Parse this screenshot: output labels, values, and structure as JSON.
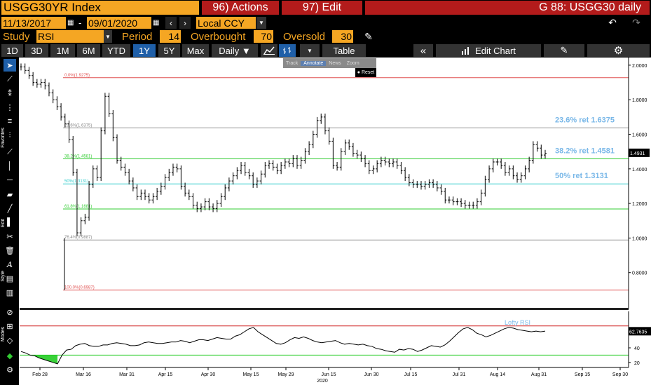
{
  "header": {
    "security": "USGG30YR Index",
    "actions": "96) Actions",
    "edit": "97) Edit",
    "title": "G 88: USGG30 daily"
  },
  "range": {
    "start": "11/13/2017",
    "dash": "-",
    "end": "09/01/2020",
    "currency": "Local CCY"
  },
  "study": {
    "label": "Study",
    "value": "RSI",
    "period_label": "Period",
    "period": "14",
    "overbought_label": "Overbought",
    "overbought": "70",
    "oversold_label": "Oversold",
    "oversold": "30"
  },
  "toolbar": {
    "periods": [
      "1D",
      "3D",
      "1M",
      "6M",
      "YTD",
      "1Y",
      "5Y",
      "Max"
    ],
    "active_period": "1Y",
    "frequency": "Daily",
    "table": "Table",
    "edit_chart": "Edit Chart"
  },
  "popup": {
    "tools": [
      "Track",
      "Annotate",
      "News",
      "Zoom"
    ],
    "reset": "Reset"
  },
  "side_labels": {
    "favorites": "Favorites",
    "edit": "Edit",
    "style": "Style",
    "modes": "Modes"
  },
  "colors": {
    "accent": "#f5a623",
    "header_red": "#b31b1b",
    "fib_red": "#e05050",
    "fib_green": "#33cc33",
    "fib_cyan": "#33cccc",
    "fib_label": "#7ab8e8"
  },
  "chart_data": [
    {
      "type": "line",
      "title": "",
      "x_ticks": [
        "Feb 28",
        "Mar 16",
        "Mar 31",
        "Apr 15",
        "Apr 30",
        "May 15",
        "May 29",
        "Jun 15",
        "Jun 30",
        "Jul 15",
        "Jul 31",
        "Aug 14",
        "Aug 31",
        "Sep 15",
        "Sep 30"
      ],
      "x_year": "2020",
      "y_ticks": [
        "2.0000",
        "1.8000",
        "1.6000",
        "1.4000",
        "1.2000",
        "1.0000",
        "0.8000"
      ],
      "ylim": [
        0.6,
        2.02
      ],
      "last_value": "1.4931",
      "fib_levels": [
        {
          "label": "0.0%(1.9275)",
          "value": 1.9275,
          "color": "red"
        },
        {
          "label": "23.6%(1.6375)",
          "value": 1.6375,
          "color": "gray"
        },
        {
          "label": "38.2%(1.4581)",
          "value": 1.4581,
          "color": "green"
        },
        {
          "label": "50%(1.3131)",
          "value": 1.3131,
          "color": "cyan"
        },
        {
          "label": "61.8%(1.1681)",
          "value": 1.1681,
          "color": "green"
        },
        {
          "label": "76.4%(0.9887)",
          "value": 0.9887,
          "color": "gray"
        },
        {
          "label": "100.0%(0.6987)",
          "value": 0.6987,
          "color": "red"
        }
      ],
      "fib_annotations": [
        "23.6% ret 1.6375",
        "38.2% ret 1.4581",
        "50% ret 1.3131"
      ],
      "series": [
        {
          "values": [
            1.99,
            1.97,
            1.94,
            1.9,
            1.89,
            1.9,
            1.88,
            1.84,
            1.8,
            1.76,
            1.7,
            1.66,
            1.57,
            1.38,
            1.03,
            1.1,
            1.12,
            1.31,
            1.4,
            1.35,
            1.62,
            1.82,
            1.72,
            1.58,
            1.45,
            1.41,
            1.38,
            1.33,
            1.29,
            1.24,
            1.26,
            1.24,
            1.22,
            1.24,
            1.27,
            1.3,
            1.35,
            1.38,
            1.41,
            1.4,
            1.3,
            1.26,
            1.24,
            1.19,
            1.17,
            1.18,
            1.21,
            1.18,
            1.17,
            1.2,
            1.24,
            1.29,
            1.33,
            1.36,
            1.39,
            1.42,
            1.38,
            1.36,
            1.31,
            1.33,
            1.37,
            1.42,
            1.43,
            1.41,
            1.39,
            1.42,
            1.44,
            1.43,
            1.46,
            1.42,
            1.45,
            1.5,
            1.54,
            1.6,
            1.68,
            1.7,
            1.62,
            1.56,
            1.42,
            1.41,
            1.5,
            1.55,
            1.53,
            1.49,
            1.48,
            1.46,
            1.43,
            1.39,
            1.4,
            1.43,
            1.45,
            1.44,
            1.43,
            1.44,
            1.42,
            1.39,
            1.35,
            1.32,
            1.31,
            1.31,
            1.3,
            1.31,
            1.32,
            1.31,
            1.29,
            1.27,
            1.22,
            1.22,
            1.21,
            1.21,
            1.2,
            1.19,
            1.19,
            1.19,
            1.21,
            1.26,
            1.34,
            1.4,
            1.44,
            1.44,
            1.42,
            1.38,
            1.4,
            1.36,
            1.34,
            1.36,
            1.4,
            1.45,
            1.54,
            1.52,
            1.48,
            1.49
          ]
        }
      ]
    },
    {
      "type": "line",
      "title": "Lofty RSI",
      "ylim": [
        15,
        90
      ],
      "y_ticks": [
        "60",
        "40",
        "20"
      ],
      "last_value": "62.7635",
      "overbought": 70,
      "oversold": 30,
      "series": [
        {
          "values": [
            35,
            33,
            30,
            29,
            26,
            24,
            22,
            20,
            18,
            30,
            37,
            38,
            43,
            45,
            46,
            43,
            42,
            42,
            44,
            44,
            46,
            47,
            46,
            45,
            43,
            43,
            44,
            47,
            48,
            47,
            46,
            46,
            47,
            48,
            48,
            50,
            49,
            47,
            49,
            51,
            51,
            50,
            52,
            54,
            53,
            52,
            52,
            56,
            58,
            62,
            66,
            68,
            62,
            58,
            54,
            50,
            46,
            45,
            47,
            51,
            54,
            53,
            55,
            53,
            50,
            48,
            47,
            48,
            49,
            50,
            47,
            45,
            46,
            45,
            44,
            45,
            43,
            42,
            39,
            38,
            36,
            35,
            34,
            38,
            37,
            39,
            38,
            35,
            37,
            40,
            43,
            42,
            41,
            44,
            49,
            55,
            61,
            66,
            68,
            65,
            60,
            58,
            55,
            57,
            60,
            63,
            66,
            68,
            67,
            65,
            64,
            63,
            62,
            63,
            62,
            63
          ]
        }
      ]
    }
  ]
}
